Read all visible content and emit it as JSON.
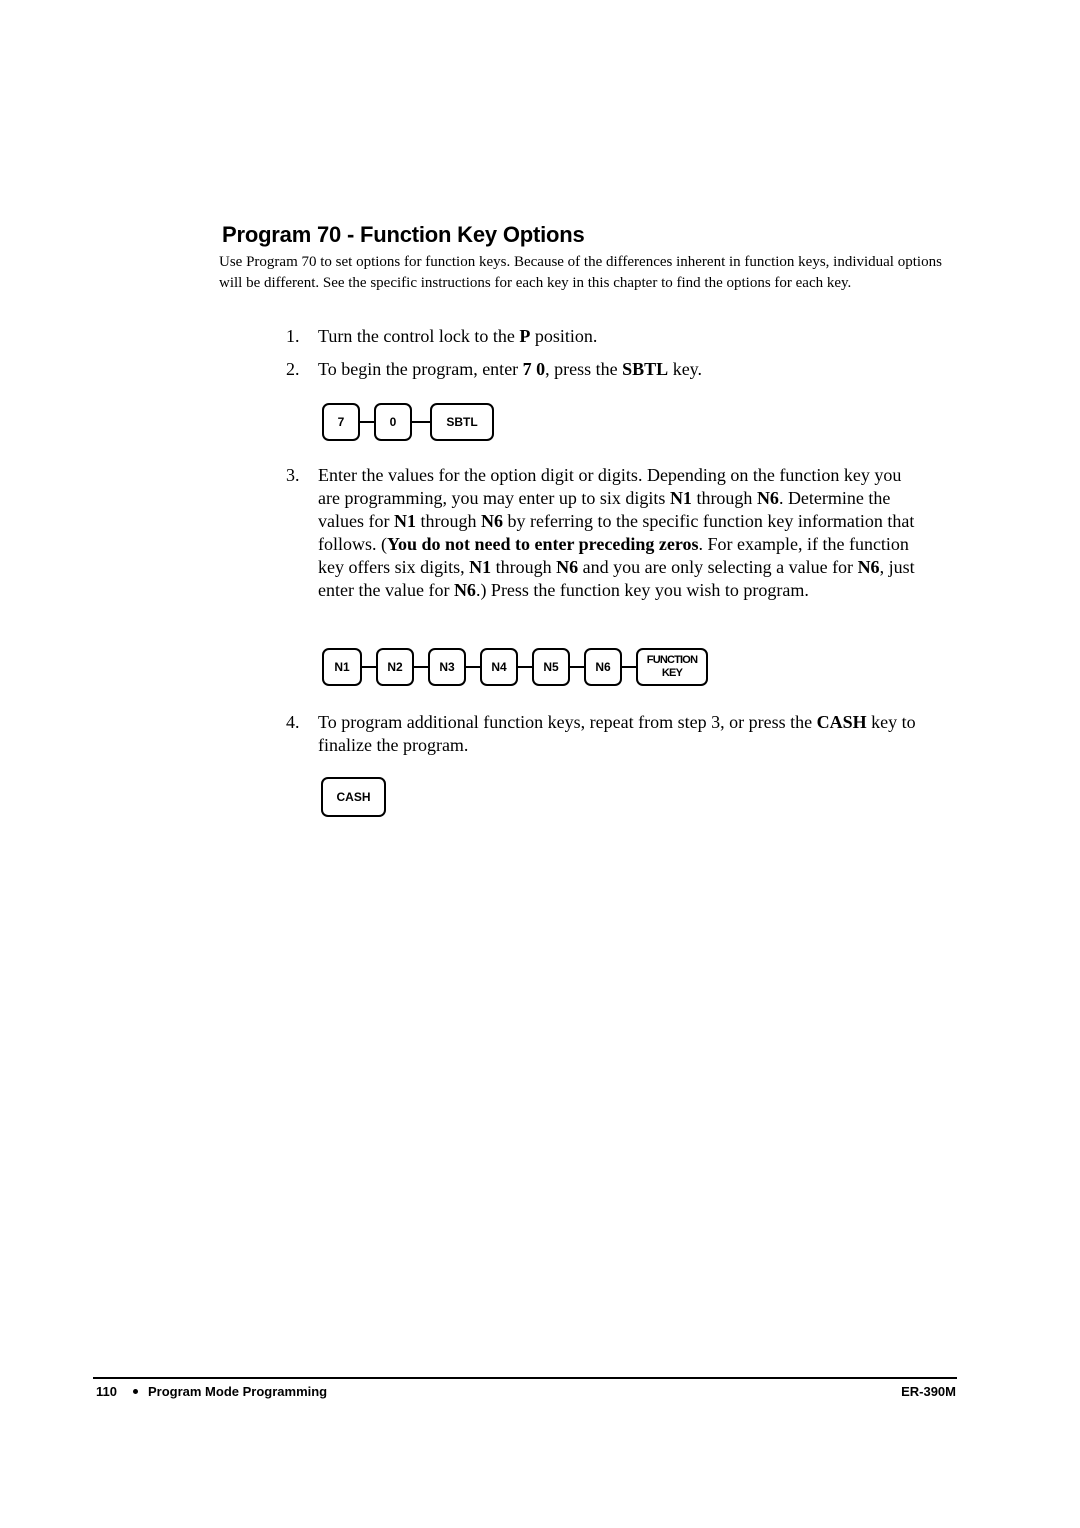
{
  "page": {
    "title": "Program 70 - Function Key Options",
    "intro": "Use Program 70 to set options for function keys. Because of the differences inherent in function keys, individual options will be different. See the specific instructions for each key in this chapter to find the options for each key."
  },
  "steps": [
    {
      "num": "1.",
      "parts": [
        "Turn the control lock to the ",
        "P",
        " position."
      ]
    },
    {
      "num": "2.",
      "parts": [
        "To begin the program, enter ",
        "7 0",
        ", press the ",
        "SBTL",
        " key."
      ],
      "keys": [
        "7",
        "0",
        "SBTL"
      ]
    },
    {
      "num": "3.",
      "parts": [
        "Enter the values for the option digit or digits. Depending on the function key you are programming, you may enter up to six digits ",
        "N1",
        " through ",
        "N6",
        ". Determine the values for ",
        "N1",
        " through ",
        "N6",
        " by referring to the specific function key information that follows. (",
        "You do not need to enter preceding zeros",
        ". For example, if the function key offers six digits, ",
        "N1",
        " through ",
        "N6",
        " and you are only selecting a value for ",
        "N6",
        ", just enter the value for ",
        "N6",
        ".)    Press the function key you wish to program."
      ],
      "keys": [
        "N1",
        "N2",
        "N3",
        "N4",
        "N5",
        "N6",
        "FUNCTION KEY"
      ]
    },
    {
      "num": "4.",
      "parts": [
        "To program additional function keys, repeat from step 3, or press the ",
        "CASH",
        " key to finalize the program."
      ],
      "keys": [
        "CASH"
      ]
    }
  ],
  "footer": {
    "page_number": "110",
    "section": "Program Mode Programming",
    "model": "ER-390M"
  }
}
